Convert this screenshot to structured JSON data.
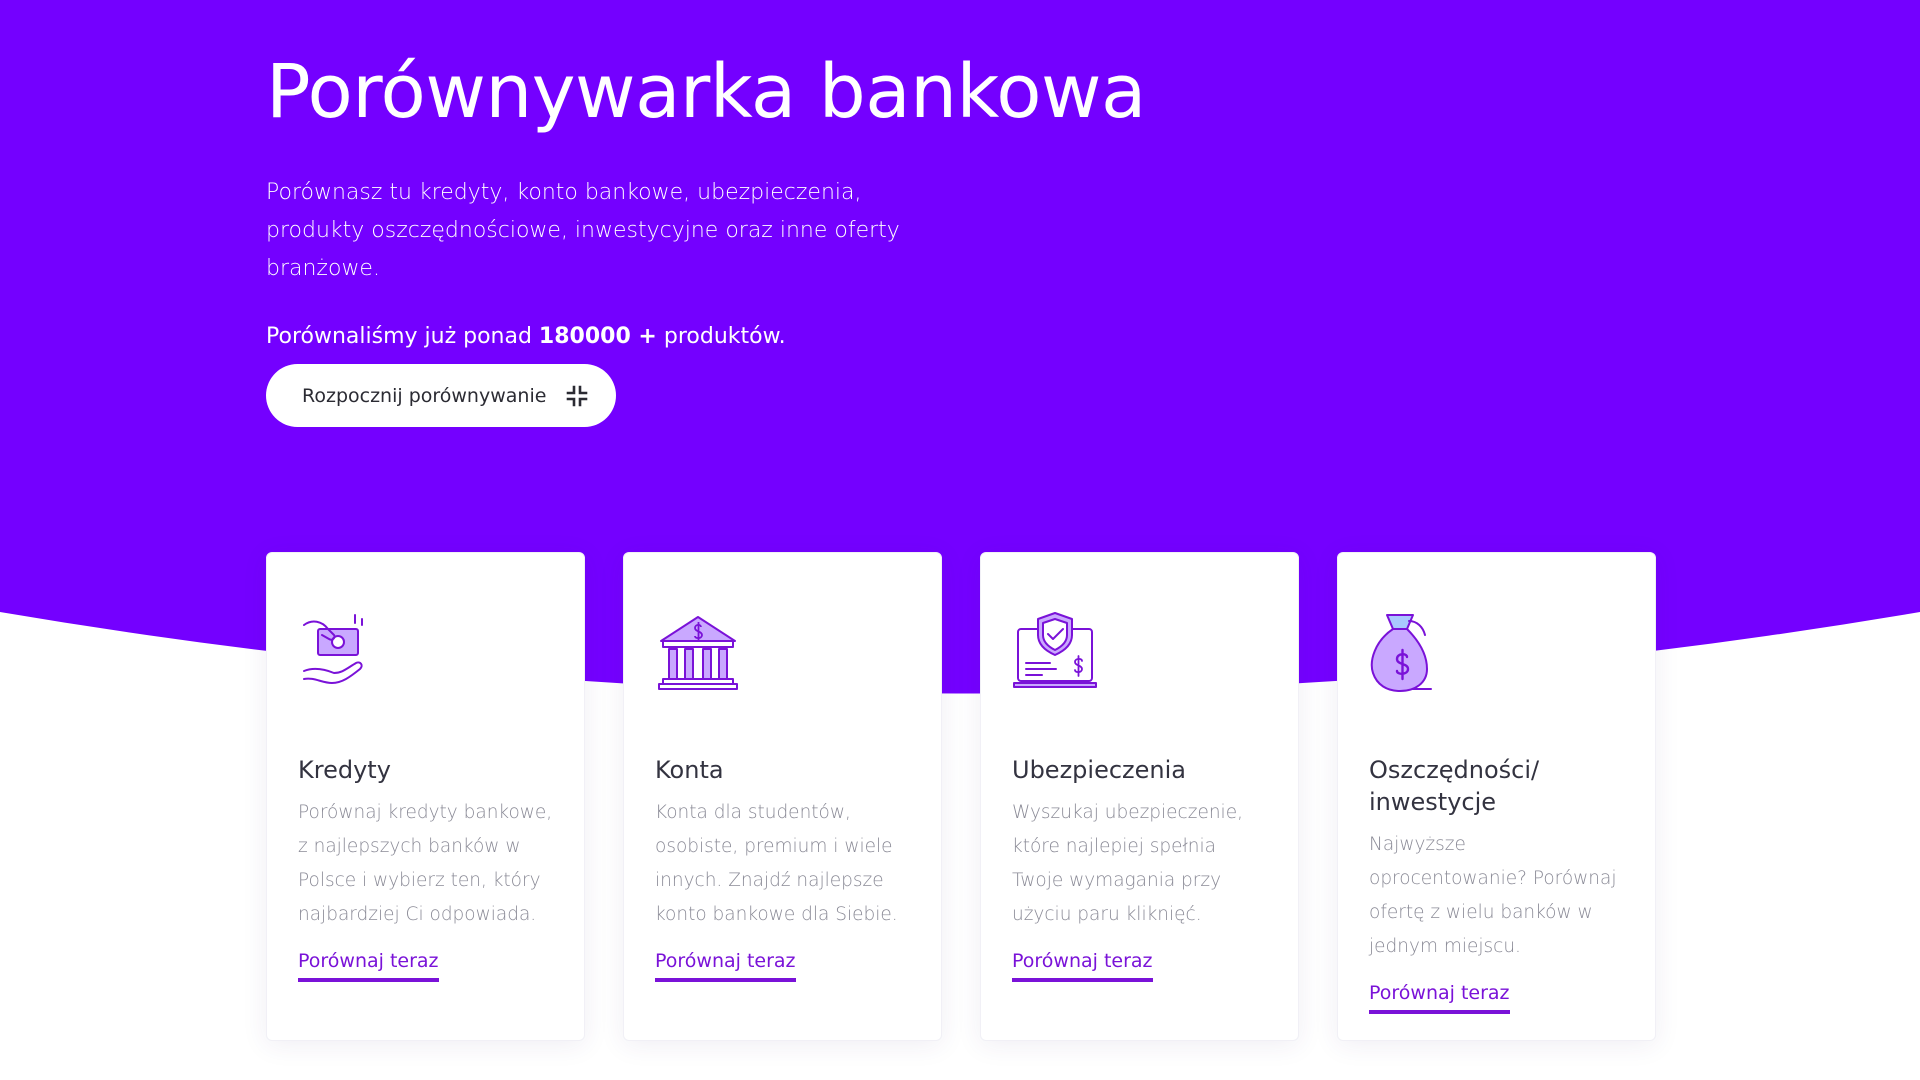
{
  "hero": {
    "title": "Porównywarka bankowa",
    "description": "Porównasz tu kredyty, konto bankowe, ubezpieczenia, produkty oszczędnościowe, inwestycyjne oraz inne oferty branżowe.",
    "count_prefix": "Porównaliśmy już ponad ",
    "count_value": "180000 +",
    "count_suffix": " produktów.",
    "cta_label": "Rozpocznij porównywanie",
    "cta_icon": "compress-icon"
  },
  "colors": {
    "brand": "#7400ff",
    "accent": "#7a12d8",
    "icon_fill": "#c9a8ff",
    "card_bg": "#ffffff"
  },
  "cards": [
    {
      "icon": "cash-hand-icon",
      "title": "Kredyty",
      "text": "Porównaj kredyty bankowe, z najlepszych banków w Polsce i wybierz ten, który najbardziej Ci odpowiada.",
      "link": "Porównaj teraz"
    },
    {
      "icon": "bank-building-icon",
      "title": "Konta",
      "text": "Konta dla studentów, osobiste, premium i wiele innych. Znajdź najlepsze konto bankowe dla Siebie.",
      "link": "Porównaj teraz"
    },
    {
      "icon": "shield-laptop-icon",
      "title": "Ubezpieczenia",
      "text": "Wyszukaj ubezpieczenie, które najlepiej spełnia Twoje wymagania przy użyciu paru kliknięć.",
      "link": "Porównaj teraz"
    },
    {
      "icon": "money-bag-icon",
      "title": "Oszczędności/ inwestycje",
      "text": "Najwyższe oprocentowanie? Porównaj ofertę z wielu banków w jednym miejscu.",
      "link": "Porównaj teraz"
    }
  ]
}
